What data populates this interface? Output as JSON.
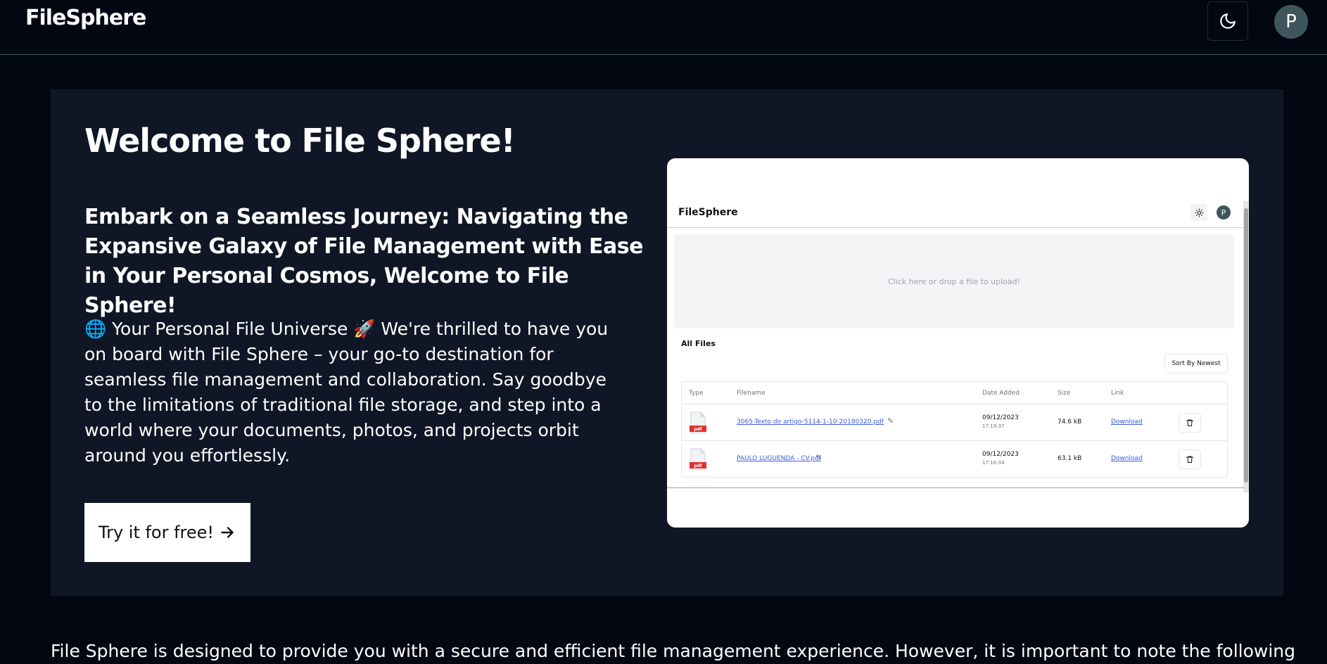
{
  "topbar": {
    "logo": "FileSphere",
    "theme_icon": "moon-icon",
    "avatar_initial": "P"
  },
  "hero": {
    "title": "Welcome to File Sphere!",
    "subtitle": "Embark on a Seamless Journey: Navigating the Expansive Galaxy of File Management with Ease in Your Personal Cosmos, Welcome to File Sphere!",
    "body": "🌐 Your Personal File Universe 🚀 We're thrilled to have you on board with File Sphere – your go-to destination for seamless file management and collaboration. Say goodbye to the limitations of traditional file storage, and step into a world where your documents, photos, and projects orbit around you effortlessly.",
    "cta_label": "Try it for free!",
    "cta_icon": "arrow-right-icon"
  },
  "preview": {
    "logo": "FileSphere",
    "theme_icon": "sun-icon",
    "avatar_initial": "P",
    "dropzone_text": "Click here or drop a file to upload!",
    "all_files_label": "All Files",
    "sort_label": "Sort By Newest",
    "columns": [
      "Type",
      "Filename",
      "Date Added",
      "Size",
      "Link"
    ],
    "rows": [
      {
        "type": "pdf",
        "filename": "3065-Texto do artigo-5114-1-10-20180320.pdf",
        "date": "09/12/2023",
        "time": "17:19:37",
        "size": "74.6 kB",
        "link": "Download"
      },
      {
        "type": "pdf",
        "filename": "PAULO LUGUENDA - CV.pdf",
        "date": "09/12/2023",
        "time": "17:16:34",
        "size": "63.1 kB",
        "link": "Download"
      }
    ]
  },
  "footer_text": "File Sphere is designed to provide you with a secure and efficient file management experience. However, it is important to note the following",
  "colors": {
    "background": "#030712",
    "hero_panel": "#0f1625",
    "avatar": "#3f555c",
    "link": "#3b5bdb",
    "pdf_red": "#e03131"
  }
}
